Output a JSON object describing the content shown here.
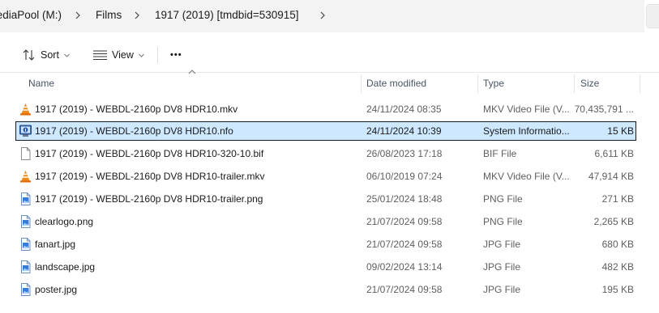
{
  "breadcrumb": {
    "items": [
      "MediaPool (M:)",
      "Films",
      "1917 (2019) [tmdbid=530915]"
    ]
  },
  "toolbar": {
    "sort_label": "Sort",
    "view_label": "View",
    "more_label": "•••"
  },
  "columns": {
    "name": "Name",
    "date": "Date modified",
    "type": "Type",
    "size": "Size"
  },
  "files": [
    {
      "icon": "vlc-icon",
      "name": "1917 (2019) - WEBDL-2160p DV8 HDR10.mkv",
      "date": "24/11/2024 08:35",
      "type": "MKV Video File (V...",
      "size": "70,435,791 ...",
      "selected": false
    },
    {
      "icon": "system-info-icon",
      "name": "1917 (2019) - WEBDL-2160p DV8 HDR10.nfo",
      "date": "24/11/2024 10:39",
      "type": "System Informatio...",
      "size": "15 KB",
      "selected": true
    },
    {
      "icon": "blank-file-icon",
      "name": "1917 (2019) - WEBDL-2160p DV8 HDR10-320-10.bif",
      "date": "26/08/2023 17:18",
      "type": "BIF File",
      "size": "6,611 KB",
      "selected": false
    },
    {
      "icon": "vlc-icon",
      "name": "1917 (2019) - WEBDL-2160p DV8 HDR10-trailer.mkv",
      "date": "06/10/2019 07:24",
      "type": "MKV Video File (V...",
      "size": "47,914 KB",
      "selected": false
    },
    {
      "icon": "image-file-icon",
      "name": "1917 (2019) - WEBDL-2160p DV8 HDR10-trailer.png",
      "date": "25/01/2024 18:48",
      "type": "PNG File",
      "size": "271 KB",
      "selected": false
    },
    {
      "icon": "image-file-icon",
      "name": "clearlogo.png",
      "date": "21/07/2024 09:58",
      "type": "PNG File",
      "size": "2,265 KB",
      "selected": false
    },
    {
      "icon": "image-file-icon",
      "name": "fanart.jpg",
      "date": "21/07/2024 09:58",
      "type": "JPG File",
      "size": "680 KB",
      "selected": false
    },
    {
      "icon": "image-file-icon",
      "name": "landscape.jpg",
      "date": "09/02/2024 13:14",
      "type": "JPG File",
      "size": "482 KB",
      "selected": false
    },
    {
      "icon": "image-file-icon",
      "name": "poster.jpg",
      "date": "21/07/2024 09:58",
      "type": "JPG File",
      "size": "195 KB",
      "selected": false
    }
  ]
}
